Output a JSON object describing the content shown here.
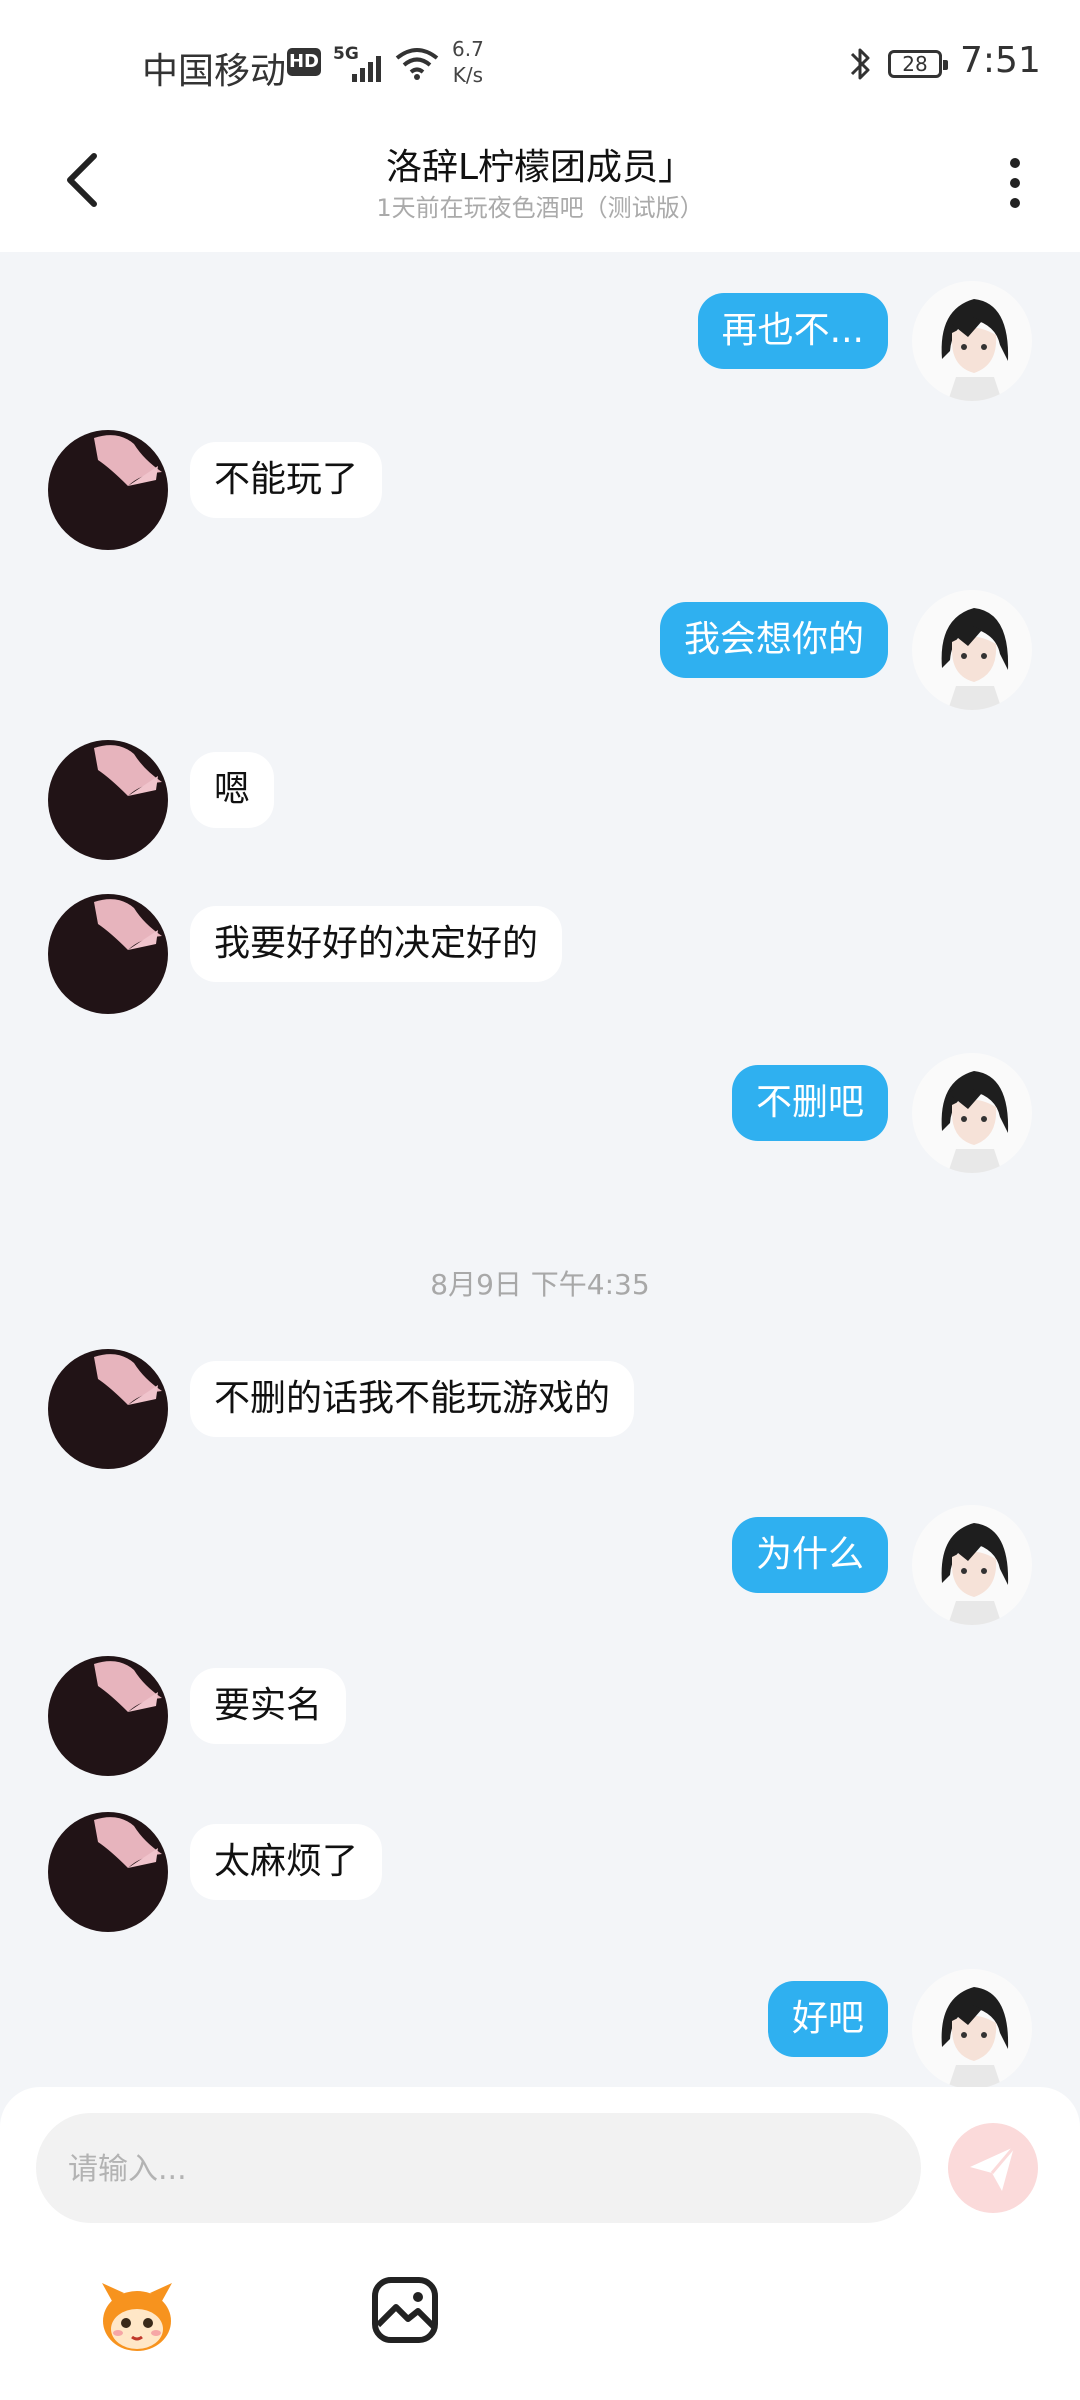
{
  "status_bar": {
    "carrier": "中国移动",
    "hd": "HD",
    "network": "5G",
    "speed_value": "6.7",
    "speed_unit": "K/s",
    "battery": "28",
    "time": "7:51"
  },
  "header": {
    "name": "洛辞L柠檬团成员」",
    "status": "1天前在玩夜色酒吧（测试版）"
  },
  "messages": [
    {
      "side": "out",
      "text": "再也不..."
    },
    {
      "side": "in",
      "text": "不能玩了"
    },
    {
      "side": "out",
      "text": "我会想你的"
    },
    {
      "side": "in",
      "text": "嗯"
    },
    {
      "side": "in",
      "text": "我要好好的决定好的"
    },
    {
      "side": "out",
      "text": "不删吧"
    },
    {
      "side": "in",
      "text": "不删的话我不能玩游戏的"
    },
    {
      "side": "out",
      "text": "为什么"
    },
    {
      "side": "in",
      "text": "要实名"
    },
    {
      "side": "in",
      "text": "太麻烦了"
    },
    {
      "side": "out",
      "text": "好吧"
    }
  ],
  "timestamp": "8月9日 下午4:35",
  "composer": {
    "placeholder": "请输入..."
  },
  "colors": {
    "outgoing_bubble": "#2fb0f0",
    "incoming_bubble": "#ffffff",
    "chat_background": "#f3f5f8",
    "send_button": "#fbdada"
  },
  "icons": [
    "back-arrow-icon",
    "more-dots-icon",
    "send-icon",
    "emoji-mascot-icon",
    "image-icon",
    "bluetooth-icon",
    "wifi-icon",
    "signal-icon"
  ]
}
